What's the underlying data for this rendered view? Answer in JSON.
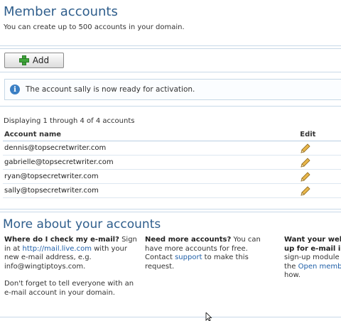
{
  "header": {
    "title": "Member accounts",
    "subtitle": "You can create up to 500 accounts in your domain."
  },
  "toolbar": {
    "add_label": "Add"
  },
  "notice": {
    "text": "The account sally is now ready for activation."
  },
  "accounts": {
    "displaying": "Displaying 1 through 4 of 4 accounts",
    "columns": {
      "name": "Account name",
      "edit": "Edit"
    },
    "rows": [
      {
        "email": "dennis@topsecretwriter.com"
      },
      {
        "email": "gabrielle@topsecretwriter.com"
      },
      {
        "email": "ryan@topsecretwriter.com"
      },
      {
        "email": "sally@topsecretwriter.com"
      }
    ]
  },
  "more": {
    "title": "More about your accounts",
    "col1": {
      "heading": "Where do I check my e-mail?",
      "text1": " Sign in at ",
      "link": "http://mail.live.com",
      "text2": " with your new e-mail address, e.g. info@wingtiptoys.com.",
      "para2": "Don't forget to tell everyone with an e-mail account in your domain."
    },
    "col2": {
      "heading": "Need more accounts?",
      "text1": " You can have more accounts for free. Contact ",
      "link": "support",
      "text2": " to make this request."
    },
    "col3": {
      "line1": "Want your webs",
      "line2": "up for e-mail in",
      "line3": "sign-up module",
      "line4a": "the ",
      "line4link": "Open memb",
      "line5": "how."
    }
  },
  "colors": {
    "accent": "#2f5e8c",
    "link": "#1f5fa8",
    "rule": "#c8d9e8"
  }
}
